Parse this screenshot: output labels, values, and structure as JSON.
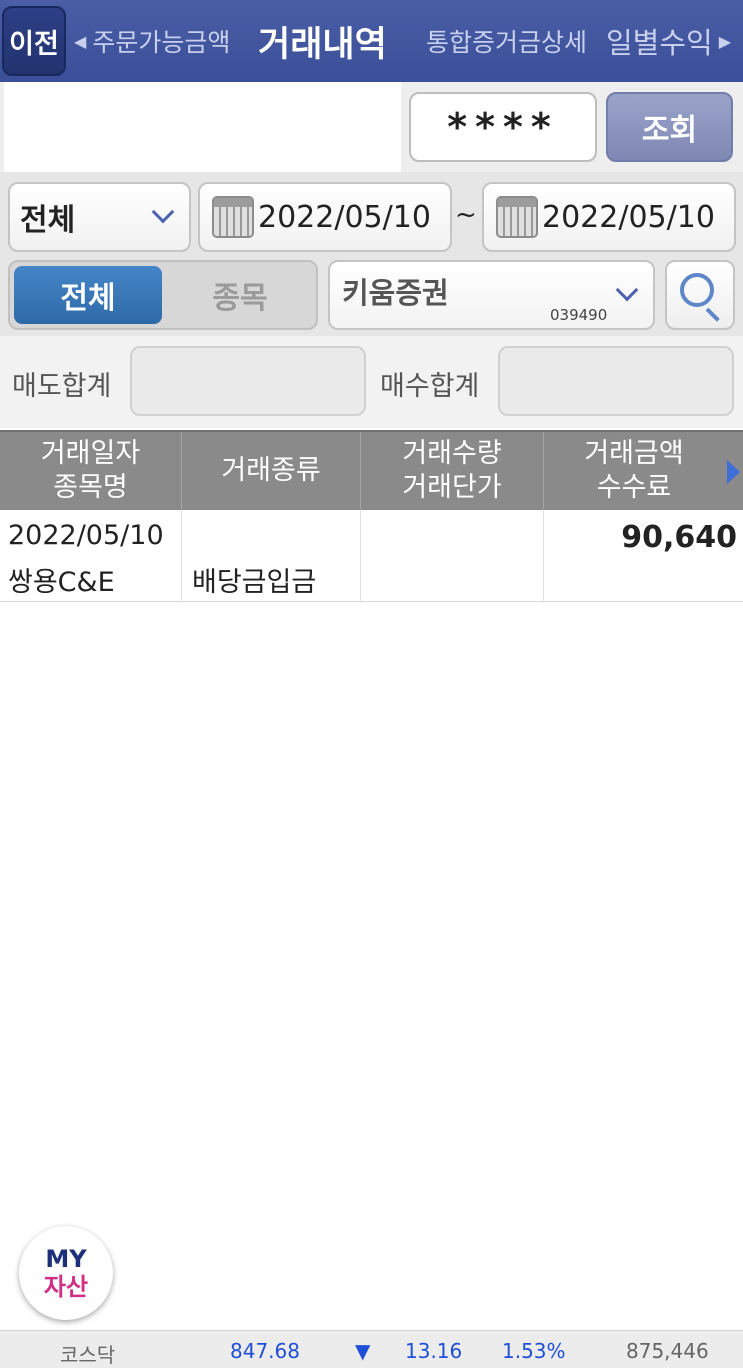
{
  "header": {
    "back_label": "이전",
    "tabs": [
      {
        "label": "주문가능금액",
        "active": false
      },
      {
        "label": "거래내역",
        "active": true
      },
      {
        "label": "통합증거금상세",
        "active": false
      },
      {
        "label": "일별수익",
        "active": false
      }
    ]
  },
  "query": {
    "password_mask": "****",
    "button_label": "조회"
  },
  "filters": {
    "type_select": "전체",
    "date_from": "2022/05/10",
    "date_to": "2022/05/10",
    "range_separator": "~",
    "toggle": {
      "options": [
        "전체",
        "종목"
      ],
      "selected": "전체"
    },
    "stock": {
      "name": "키움증권",
      "code": "039490"
    }
  },
  "totals": {
    "sell_label": "매도합계",
    "buy_label": "매수합계",
    "sell_value": "",
    "buy_value": ""
  },
  "table": {
    "headers": [
      {
        "line1": "거래일자",
        "line2": "종목명"
      },
      {
        "line1": "거래종류",
        "line2": ""
      },
      {
        "line1": "거래수량",
        "line2": "거래단가"
      },
      {
        "line1": "거래금액",
        "line2": "수수료"
      }
    ],
    "rows": [
      {
        "date": "2022/05/10",
        "stock_name": "쌍용C&E",
        "trade_type": "배당금입금",
        "quantity": "",
        "price": "",
        "amount": "90,640",
        "fee": ""
      }
    ]
  },
  "my_button": {
    "line1": "MY",
    "line2": "자산"
  },
  "ticker": {
    "index_name": "코스닥",
    "value": "847.68",
    "direction_symbol": "▼",
    "change": "13.16",
    "change_pct": "1.53%",
    "volume": "875,446",
    "colors": {
      "up_down": "#1f4fd6",
      "neutral": "#666666"
    }
  }
}
